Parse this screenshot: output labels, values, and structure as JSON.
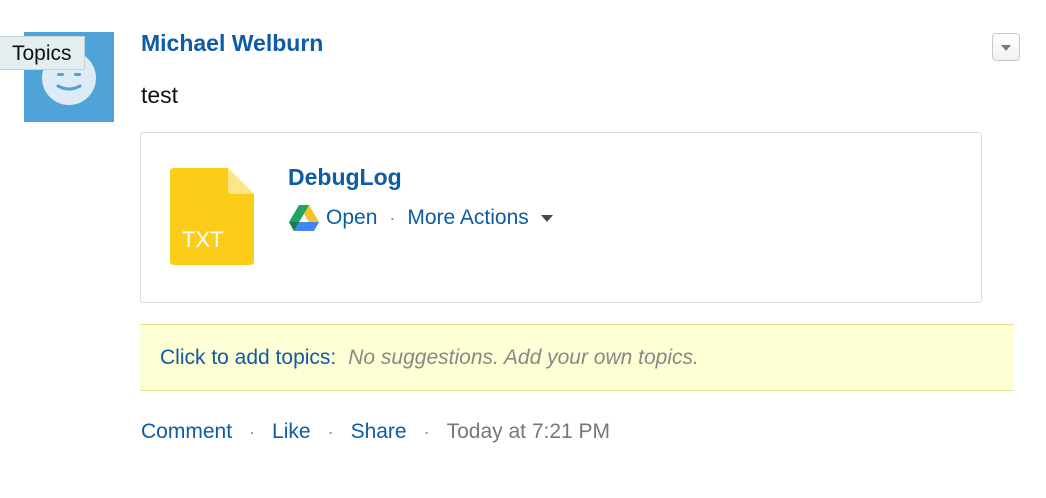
{
  "tooltip": {
    "label": "Topics"
  },
  "post": {
    "author": "Michael Welburn",
    "body": "test",
    "menu_icon": "chevron-down-icon"
  },
  "attachment": {
    "file_name": "DebugLog",
    "file_type": "TXT",
    "file_color": "#fbcd18",
    "open_label": "Open",
    "separator": "·",
    "more_actions_label": "More Actions"
  },
  "topics": {
    "add_label": "Click to add topics:",
    "hint": "No suggestions. Add your own topics.",
    "bar_color": "#ffffd6"
  },
  "footer": {
    "comment_label": "Comment",
    "like_label": "Like",
    "share_label": "Share",
    "separator": "·",
    "timestamp": "Today at 7:21 PM"
  },
  "colors": {
    "link": "#0e5ba6",
    "avatar_bg": "#4fa3d8"
  }
}
